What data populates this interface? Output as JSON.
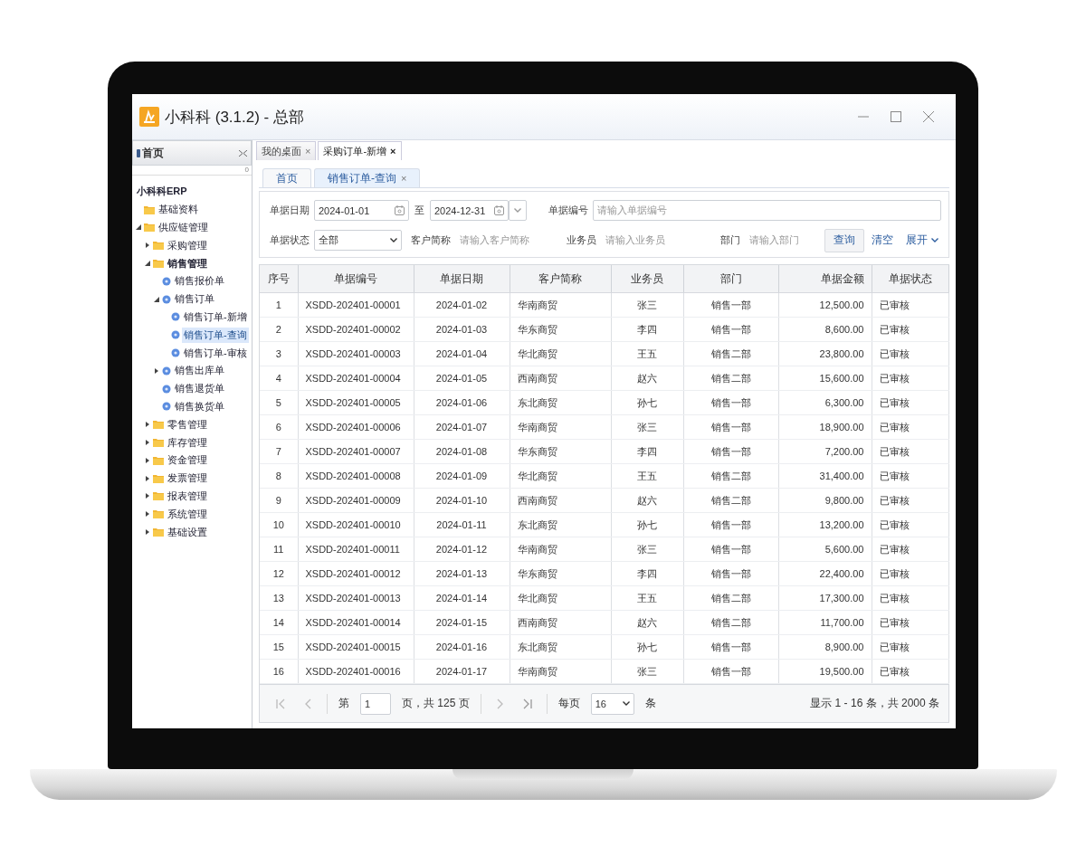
{
  "window": {
    "title": "小科科 (3.1.2) - 总部"
  },
  "sidebar": {
    "header": "首页",
    "counter": "0",
    "tree": [
      {
        "label": "小科科ERP",
        "bold": true,
        "selected": false,
        "children": [
          {
            "label": "基础资料",
            "kind": "folder",
            "selected": false
          },
          {
            "label": "供应链管理",
            "kind": "folder",
            "expanded": true,
            "selected": false,
            "children": [
              {
                "label": "采购管理",
                "kind": "folder",
                "expanded": false,
                "selected": false
              },
              {
                "label": "销售管理",
                "kind": "folder",
                "expanded": true,
                "bold": true,
                "selected": false,
                "children": [
                  {
                    "label": "销售报价单",
                    "kind": "doc",
                    "selected": false
                  },
                  {
                    "label": "销售订单",
                    "kind": "doc",
                    "expanded": true,
                    "selected": false,
                    "children": [
                      {
                        "label": "销售订单-新增",
                        "kind": "doc",
                        "selected": false
                      },
                      {
                        "label": "销售订单-查询",
                        "kind": "doc",
                        "selected": true
                      },
                      {
                        "label": "销售订单-审核",
                        "kind": "doc",
                        "selected": false
                      }
                    ]
                  },
                  {
                    "label": "销售出库单",
                    "kind": "doc",
                    "expanded": false,
                    "selected": false
                  },
                  {
                    "label": "销售退货单",
                    "kind": "doc",
                    "selected": false
                  },
                  {
                    "label": "销售换货单",
                    "kind": "doc",
                    "selected": false
                  }
                ]
              },
              {
                "label": "零售管理",
                "kind": "folder",
                "expanded": false,
                "selected": false
              },
              {
                "label": "库存管理",
                "kind": "folder",
                "expanded": false,
                "selected": false
              },
              {
                "label": "资金管理",
                "kind": "folder",
                "expanded": false,
                "selected": false
              },
              {
                "label": "发票管理",
                "kind": "folder",
                "expanded": false,
                "selected": false
              },
              {
                "label": "报表管理",
                "kind": "folder",
                "expanded": false,
                "selected": false
              },
              {
                "label": "系统管理",
                "kind": "folder",
                "expanded": false,
                "selected": false
              },
              {
                "label": "基础设置",
                "kind": "folder",
                "expanded": false,
                "selected": false
              }
            ]
          }
        ]
      }
    ]
  },
  "outer_tabs": [
    {
      "label": "我的桌面",
      "close": "×",
      "selected": false
    },
    {
      "label": "采购订单-新增",
      "close": "×",
      "selected": true
    }
  ],
  "inner_tabs": [
    {
      "label": "首页",
      "selected": false
    },
    {
      "label": "销售订单-查询",
      "close": "×",
      "selected": true
    }
  ],
  "filters": {
    "date_label": "单据日期",
    "date_from": "2024-01-01",
    "date_sep": "至",
    "date_to": "2024-12-31",
    "number_label": "单据编号",
    "number_placeholder": "请输入单据编号",
    "status_label": "单据状态",
    "status_value": "全部",
    "customer_label": "客户简称",
    "customer_placeholder": "请输入客户简称",
    "salesperson_label": "业务员",
    "salesperson_placeholder": "请输入业务员",
    "dept_label": "部门",
    "dept_placeholder": "请输入部门",
    "query_button": "查询",
    "clear_button": "清空",
    "expand_link": "展开"
  },
  "table": {
    "columns": [
      "序号",
      "单据编号",
      "单据日期",
      "客户简称",
      "业务员",
      "部门",
      "单据金额",
      "单据状态"
    ],
    "rows": [
      [
        "1",
        "XSDD-202401-00001",
        "2024-01-02",
        "华南商贸",
        "张三",
        "销售一部",
        "12,500.00",
        "已审核"
      ],
      [
        "2",
        "XSDD-202401-00002",
        "2024-01-03",
        "华东商贸",
        "李四",
        "销售一部",
        "8,600.00",
        "已审核"
      ],
      [
        "3",
        "XSDD-202401-00003",
        "2024-01-04",
        "华北商贸",
        "王五",
        "销售二部",
        "23,800.00",
        "已审核"
      ],
      [
        "4",
        "XSDD-202401-00004",
        "2024-01-05",
        "西南商贸",
        "赵六",
        "销售二部",
        "15,600.00",
        "已审核"
      ],
      [
        "5",
        "XSDD-202401-00005",
        "2024-01-06",
        "东北商贸",
        "孙七",
        "销售一部",
        "6,300.00",
        "已审核"
      ],
      [
        "6",
        "XSDD-202401-00006",
        "2024-01-07",
        "华南商贸",
        "张三",
        "销售一部",
        "18,900.00",
        "已审核"
      ],
      [
        "7",
        "XSDD-202401-00007",
        "2024-01-08",
        "华东商贸",
        "李四",
        "销售一部",
        "7,200.00",
        "已审核"
      ],
      [
        "8",
        "XSDD-202401-00008",
        "2024-01-09",
        "华北商贸",
        "王五",
        "销售二部",
        "31,400.00",
        "已审核"
      ],
      [
        "9",
        "XSDD-202401-00009",
        "2024-01-10",
        "西南商贸",
        "赵六",
        "销售二部",
        "9,800.00",
        "已审核"
      ],
      [
        "10",
        "XSDD-202401-00010",
        "2024-01-11",
        "东北商贸",
        "孙七",
        "销售一部",
        "13,200.00",
        "已审核"
      ],
      [
        "11",
        "XSDD-202401-00011",
        "2024-01-12",
        "华南商贸",
        "张三",
        "销售一部",
        "5,600.00",
        "已审核"
      ],
      [
        "12",
        "XSDD-202401-00012",
        "2024-01-13",
        "华东商贸",
        "李四",
        "销售一部",
        "22,400.00",
        "已审核"
      ],
      [
        "13",
        "XSDD-202401-00013",
        "2024-01-14",
        "华北商贸",
        "王五",
        "销售二部",
        "17,300.00",
        "已审核"
      ],
      [
        "14",
        "XSDD-202401-00014",
        "2024-01-15",
        "西南商贸",
        "赵六",
        "销售二部",
        "11,700.00",
        "已审核"
      ],
      [
        "15",
        "XSDD-202401-00015",
        "2024-01-16",
        "东北商贸",
        "孙七",
        "销售一部",
        "8,900.00",
        "已审核"
      ],
      [
        "16",
        "XSDD-202401-00016",
        "2024-01-17",
        "华南商贸",
        "张三",
        "销售一部",
        "19,500.00",
        "已审核"
      ]
    ]
  },
  "pagination": {
    "page_prefix": "第",
    "page": "1",
    "page_suffix": "页，共 125 页",
    "per_page_label": "每页",
    "per_page": "16",
    "per_page_unit": "条",
    "summary": "显示 1 - 16 条，共 2000 条"
  }
}
